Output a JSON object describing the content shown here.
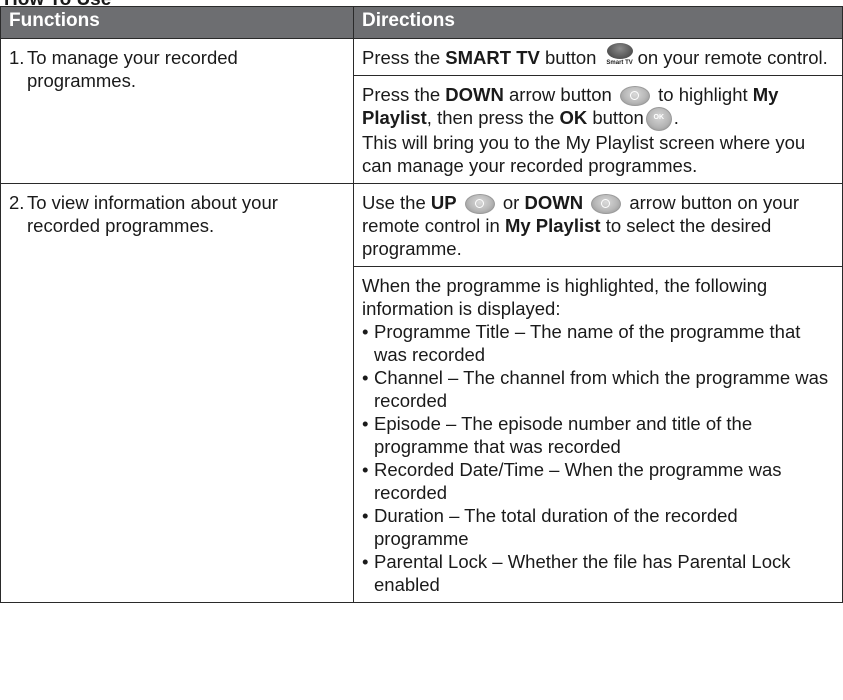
{
  "heading_fragment": "How To Use",
  "table": {
    "headers": [
      "Functions",
      "Directions"
    ],
    "rows": [
      {
        "number": "1.",
        "function": "To manage your recorded programmes.",
        "directions": [
          {
            "text_1": "Press the ",
            "bold_1": "SMART TV",
            "text_2": " button ",
            "text_3": "on your remote control."
          },
          {
            "text_1": "Press the ",
            "bold_1": "DOWN",
            "text_2": " arrow button ",
            "text_3": " to highlight ",
            "bold_2": "My Playlist",
            "text_4": ", then press the ",
            "bold_3": "OK",
            "text_5": " button",
            "text_6": ".",
            "text_7": "This will bring you to the My Playlist screen where you can manage your recorded programmes."
          }
        ]
      },
      {
        "number": "2.",
        "function": "To view information about your recorded programmes.",
        "directions": [
          {
            "text_1": "Use the ",
            "bold_1": "UP",
            "text_2": " or ",
            "bold_2": "DOWN",
            "text_3": " arrow button on your remote control in ",
            "bold_3": "My Playlist",
            "text_4": " to select the desired programme."
          },
          {
            "intro": "When the programme is highlighted, the following information is displayed:",
            "bullets": [
              "Programme Title – The name of the programme that was recorded",
              "Channel – The channel from which the programme was recorded",
              "Episode – The episode number and title of the programme that was recorded",
              "Recorded Date/Time – When the programme was recorded",
              "Duration – The total duration of the recorded programme",
              "Parental Lock – Whether the file has Parental Lock enabled"
            ]
          }
        ]
      }
    ]
  },
  "icons": {
    "smart_tv_label": "Smart TV",
    "ok_label": "OK",
    "smart_tv_button": "smart-tv-button-icon",
    "down_arrow_button": "down-arrow-button-icon",
    "up_arrow_button": "up-arrow-button-icon",
    "ok_button": "ok-button-icon"
  },
  "colors": {
    "header_background": "#6d6e71",
    "header_text": "#ffffff",
    "border": "#2a2a2a"
  }
}
